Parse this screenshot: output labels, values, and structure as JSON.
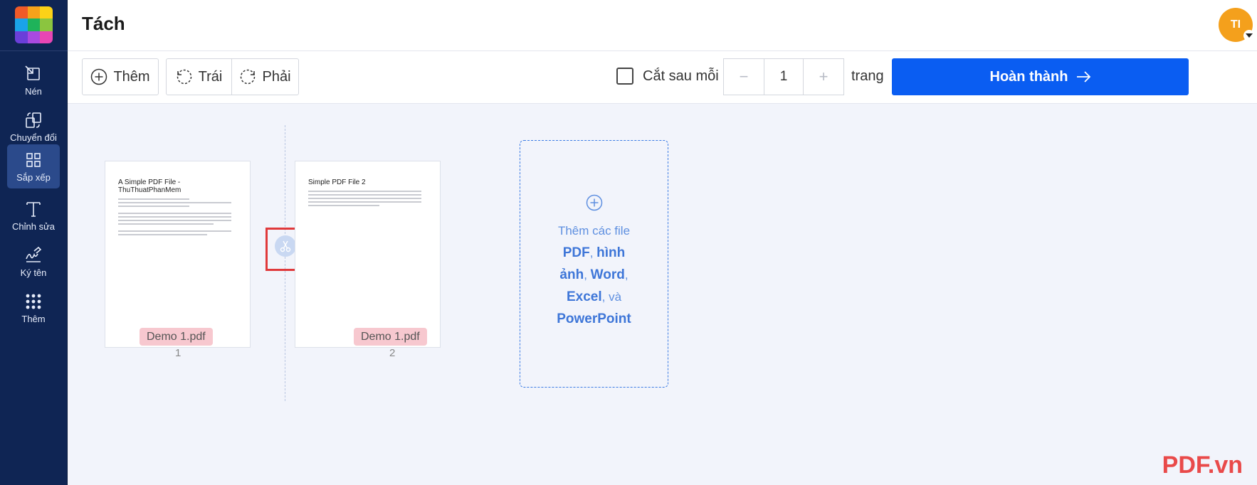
{
  "app": {
    "title": "Tách"
  },
  "logo": {
    "colors": [
      "#f05a28",
      "#f7a21b",
      "#fcd217",
      "#1aa3e8",
      "#1fb35a",
      "#8bc53f",
      "#6a3fd9",
      "#a84ae0",
      "#e846b4"
    ]
  },
  "sidebar": {
    "items": [
      {
        "label": "Nén",
        "icon": "compress-icon"
      },
      {
        "label": "Chuyển đổi",
        "icon": "convert-icon"
      },
      {
        "label": "Sắp xếp",
        "icon": "grid-icon",
        "active": true
      },
      {
        "label": "Chỉnh sửa",
        "icon": "text-icon"
      },
      {
        "label": "Ký tên",
        "icon": "signature-icon"
      },
      {
        "label": "Thêm",
        "icon": "dots-grid-icon"
      }
    ]
  },
  "user": {
    "initials": "TI",
    "color": "#f4a01c"
  },
  "toolbar": {
    "add_label": "Thêm",
    "rotate_left_label": "Trái",
    "rotate_right_label": "Phải",
    "cut_after_label": "Cắt sau mỗi",
    "minus_label": "−",
    "cut_value": "1",
    "plus_label": "+",
    "pages_unit": "trang",
    "done_label": "Hoàn thành",
    "accent": "#0a5df2"
  },
  "pages": [
    {
      "title": "A Simple PDF File - ThuThuatPhanMem",
      "file": "Demo 1.pdf",
      "number": "1"
    },
    {
      "title": "Simple PDF File 2",
      "file": "Demo 1.pdf",
      "number": "2"
    }
  ],
  "add_zone": {
    "line1": "Thêm các file",
    "pdf": "PDF",
    "sep1": ", ",
    "image": "hình ảnh",
    "sep2": ", ",
    "word": "Word",
    "sep3": ", ",
    "excel": "Excel",
    "and": ", và",
    "ppt": "PowerPoint"
  },
  "watermark": "PDF.vn"
}
